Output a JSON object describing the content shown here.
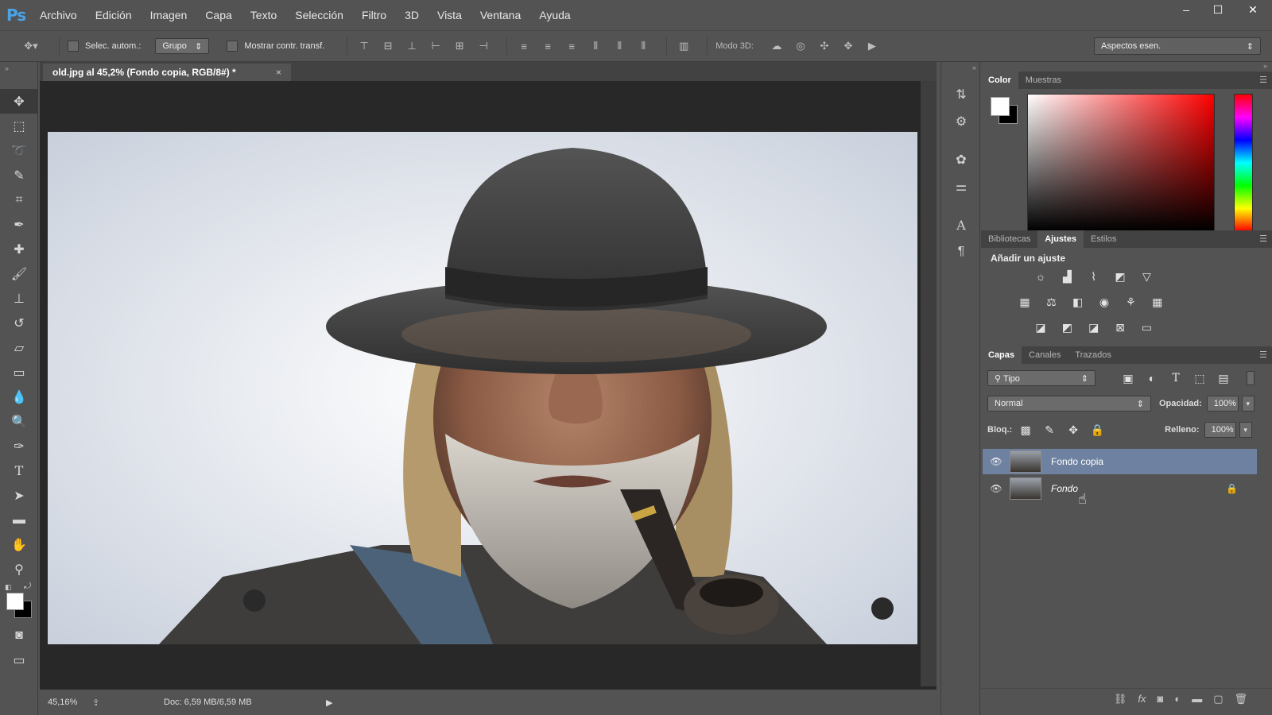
{
  "app": {
    "logo": "Ps"
  },
  "menu": [
    "Archivo",
    "Edición",
    "Imagen",
    "Capa",
    "Texto",
    "Selección",
    "Filtro",
    "3D",
    "Vista",
    "Ventana",
    "Ayuda"
  ],
  "window_controls": {
    "minimize": "–",
    "maximize": "☐",
    "close": "✕"
  },
  "options": {
    "auto_select_label": "Selec. autom.:",
    "auto_select_value": "Grupo",
    "show_transform_label": "Mostrar contr. transf.",
    "mode3d_label": "Modo 3D:",
    "workspace": "Aspectos esen."
  },
  "document": {
    "tab_title": "old.jpg al 45,2% (Fondo copia, RGB/8#) *",
    "close": "×",
    "zoom": "45,16%",
    "doc_info": "Doc: 6,59 MB/6,59 MB"
  },
  "color_panel": {
    "tabs": [
      "Color",
      "Muestras"
    ],
    "active_tab": "Color",
    "foreground": "#ffffff",
    "background": "#000000"
  },
  "adjust_panel": {
    "tabs": [
      "Bibliotecas",
      "Ajustes",
      "Estilos"
    ],
    "active_tab": "Ajustes",
    "title": "Añadir un ajuste",
    "icons_row1": [
      "brightness-icon",
      "levels-icon",
      "curves-icon",
      "exposure-icon",
      "vibrance-icon"
    ],
    "icons_row2": [
      "hue-saturation-icon",
      "color-balance-icon",
      "black-white-icon",
      "photo-filter-icon",
      "channel-mixer-icon",
      "color-lookup-icon"
    ],
    "icons_row3": [
      "invert-icon",
      "posterize-icon",
      "threshold-icon",
      "selective-color-icon",
      "gradient-map-icon"
    ]
  },
  "layers_panel": {
    "tabs": [
      "Capas",
      "Canales",
      "Trazados"
    ],
    "active_tab": "Capas",
    "filter": "Tipo",
    "blend_mode": "Normal",
    "opacity_label": "Opacidad:",
    "opacity": "100%",
    "lock_label": "Bloq.:",
    "fill_label": "Relleno:",
    "fill": "100%",
    "layers": [
      {
        "name": "Fondo copia",
        "selected": true,
        "locked": false
      },
      {
        "name": "Fondo",
        "selected": false,
        "locked": true
      }
    ]
  },
  "colors": {
    "bg": "#535353",
    "selected_layer": "#6e81a0",
    "logo": "#4aa3e6"
  }
}
